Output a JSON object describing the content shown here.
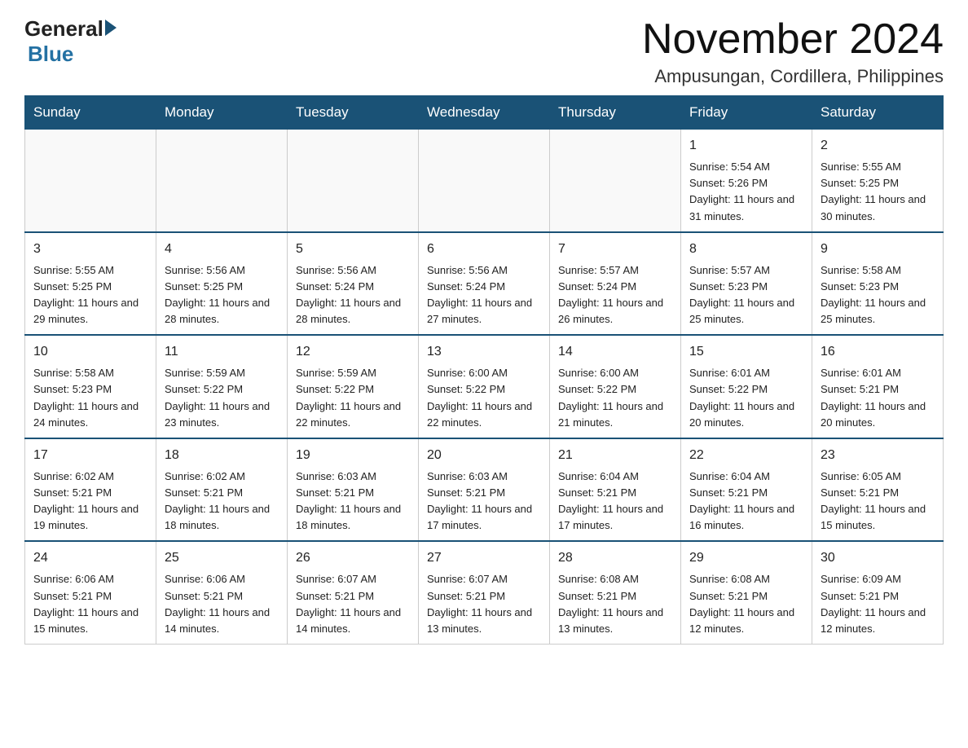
{
  "logo": {
    "text_general": "General",
    "text_blue": "Blue"
  },
  "header": {
    "month_title": "November 2024",
    "location": "Ampusungan, Cordillera, Philippines"
  },
  "days_of_week": [
    "Sunday",
    "Monday",
    "Tuesday",
    "Wednesday",
    "Thursday",
    "Friday",
    "Saturday"
  ],
  "weeks": [
    [
      {
        "day": "",
        "info": ""
      },
      {
        "day": "",
        "info": ""
      },
      {
        "day": "",
        "info": ""
      },
      {
        "day": "",
        "info": ""
      },
      {
        "day": "",
        "info": ""
      },
      {
        "day": "1",
        "info": "Sunrise: 5:54 AM\nSunset: 5:26 PM\nDaylight: 11 hours and 31 minutes."
      },
      {
        "day": "2",
        "info": "Sunrise: 5:55 AM\nSunset: 5:25 PM\nDaylight: 11 hours and 30 minutes."
      }
    ],
    [
      {
        "day": "3",
        "info": "Sunrise: 5:55 AM\nSunset: 5:25 PM\nDaylight: 11 hours and 29 minutes."
      },
      {
        "day": "4",
        "info": "Sunrise: 5:56 AM\nSunset: 5:25 PM\nDaylight: 11 hours and 28 minutes."
      },
      {
        "day": "5",
        "info": "Sunrise: 5:56 AM\nSunset: 5:24 PM\nDaylight: 11 hours and 28 minutes."
      },
      {
        "day": "6",
        "info": "Sunrise: 5:56 AM\nSunset: 5:24 PM\nDaylight: 11 hours and 27 minutes."
      },
      {
        "day": "7",
        "info": "Sunrise: 5:57 AM\nSunset: 5:24 PM\nDaylight: 11 hours and 26 minutes."
      },
      {
        "day": "8",
        "info": "Sunrise: 5:57 AM\nSunset: 5:23 PM\nDaylight: 11 hours and 25 minutes."
      },
      {
        "day": "9",
        "info": "Sunrise: 5:58 AM\nSunset: 5:23 PM\nDaylight: 11 hours and 25 minutes."
      }
    ],
    [
      {
        "day": "10",
        "info": "Sunrise: 5:58 AM\nSunset: 5:23 PM\nDaylight: 11 hours and 24 minutes."
      },
      {
        "day": "11",
        "info": "Sunrise: 5:59 AM\nSunset: 5:22 PM\nDaylight: 11 hours and 23 minutes."
      },
      {
        "day": "12",
        "info": "Sunrise: 5:59 AM\nSunset: 5:22 PM\nDaylight: 11 hours and 22 minutes."
      },
      {
        "day": "13",
        "info": "Sunrise: 6:00 AM\nSunset: 5:22 PM\nDaylight: 11 hours and 22 minutes."
      },
      {
        "day": "14",
        "info": "Sunrise: 6:00 AM\nSunset: 5:22 PM\nDaylight: 11 hours and 21 minutes."
      },
      {
        "day": "15",
        "info": "Sunrise: 6:01 AM\nSunset: 5:22 PM\nDaylight: 11 hours and 20 minutes."
      },
      {
        "day": "16",
        "info": "Sunrise: 6:01 AM\nSunset: 5:21 PM\nDaylight: 11 hours and 20 minutes."
      }
    ],
    [
      {
        "day": "17",
        "info": "Sunrise: 6:02 AM\nSunset: 5:21 PM\nDaylight: 11 hours and 19 minutes."
      },
      {
        "day": "18",
        "info": "Sunrise: 6:02 AM\nSunset: 5:21 PM\nDaylight: 11 hours and 18 minutes."
      },
      {
        "day": "19",
        "info": "Sunrise: 6:03 AM\nSunset: 5:21 PM\nDaylight: 11 hours and 18 minutes."
      },
      {
        "day": "20",
        "info": "Sunrise: 6:03 AM\nSunset: 5:21 PM\nDaylight: 11 hours and 17 minutes."
      },
      {
        "day": "21",
        "info": "Sunrise: 6:04 AM\nSunset: 5:21 PM\nDaylight: 11 hours and 17 minutes."
      },
      {
        "day": "22",
        "info": "Sunrise: 6:04 AM\nSunset: 5:21 PM\nDaylight: 11 hours and 16 minutes."
      },
      {
        "day": "23",
        "info": "Sunrise: 6:05 AM\nSunset: 5:21 PM\nDaylight: 11 hours and 15 minutes."
      }
    ],
    [
      {
        "day": "24",
        "info": "Sunrise: 6:06 AM\nSunset: 5:21 PM\nDaylight: 11 hours and 15 minutes."
      },
      {
        "day": "25",
        "info": "Sunrise: 6:06 AM\nSunset: 5:21 PM\nDaylight: 11 hours and 14 minutes."
      },
      {
        "day": "26",
        "info": "Sunrise: 6:07 AM\nSunset: 5:21 PM\nDaylight: 11 hours and 14 minutes."
      },
      {
        "day": "27",
        "info": "Sunrise: 6:07 AM\nSunset: 5:21 PM\nDaylight: 11 hours and 13 minutes."
      },
      {
        "day": "28",
        "info": "Sunrise: 6:08 AM\nSunset: 5:21 PM\nDaylight: 11 hours and 13 minutes."
      },
      {
        "day": "29",
        "info": "Sunrise: 6:08 AM\nSunset: 5:21 PM\nDaylight: 11 hours and 12 minutes."
      },
      {
        "day": "30",
        "info": "Sunrise: 6:09 AM\nSunset: 5:21 PM\nDaylight: 11 hours and 12 minutes."
      }
    ]
  ]
}
